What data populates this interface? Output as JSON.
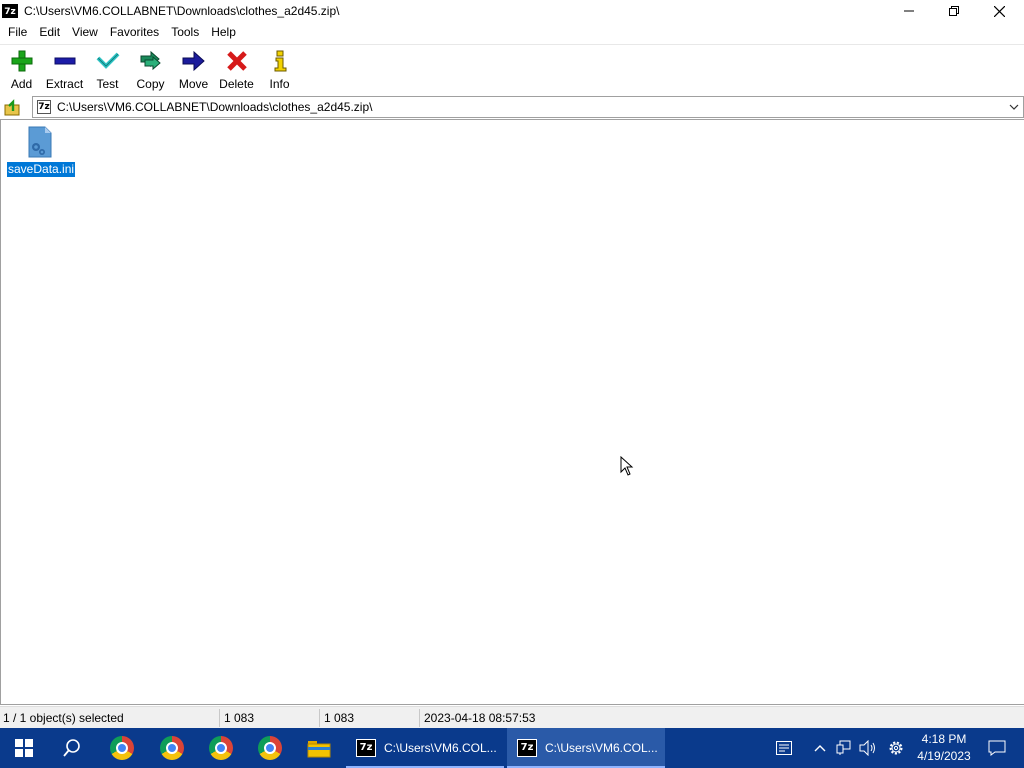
{
  "window": {
    "title": "C:\\Users\\VM6.COLLABNET\\Downloads\\clothes_a2d45.zip\\",
    "app_icon": "7z",
    "controls": {
      "minimize_icon": "minimize-icon",
      "maximize_icon": "restore-icon",
      "close_icon": "close-icon"
    }
  },
  "menu": [
    "File",
    "Edit",
    "View",
    "Favorites",
    "Tools",
    "Help"
  ],
  "toolbar": [
    {
      "label": "Add",
      "icon": "plus-icon",
      "color": "#1aa51a"
    },
    {
      "label": "Extract",
      "icon": "minus-icon",
      "color": "#1c1ca8"
    },
    {
      "label": "Test",
      "icon": "check-icon",
      "color": "#2ec4c4"
    },
    {
      "label": "Copy",
      "icon": "double-arrow-icon",
      "color": "#1a8a5a"
    },
    {
      "label": "Move",
      "icon": "arrow-right-icon",
      "color": "#1c1c9c"
    },
    {
      "label": "Delete",
      "icon": "x-icon",
      "color": "#d61a1a"
    },
    {
      "label": "Info",
      "icon": "info-icon",
      "color": "#c8a800"
    }
  ],
  "address": {
    "path": "C:\\Users\\VM6.COLLABNET\\Downloads\\clothes_a2d45.zip\\",
    "icon": "7z"
  },
  "files": [
    {
      "name": "saveData.ini",
      "selected": true,
      "icon": "ini-file-icon"
    }
  ],
  "status": {
    "selection": "1 / 1 object(s) selected",
    "size": "1 083",
    "packed": "1 083",
    "modified": "2023-04-18 08:57:53"
  },
  "taskbar": {
    "apps": [
      {
        "label": "C:\\Users\\VM6.COL...",
        "icon": "7z",
        "active": false
      },
      {
        "label": "C:\\Users\\VM6.COL...",
        "icon": "7z",
        "active": true
      }
    ],
    "time": "4:18 PM",
    "date": "4/19/2023"
  },
  "colors": {
    "selection": "#0078d7",
    "taskbar": "#0a3a8c"
  }
}
